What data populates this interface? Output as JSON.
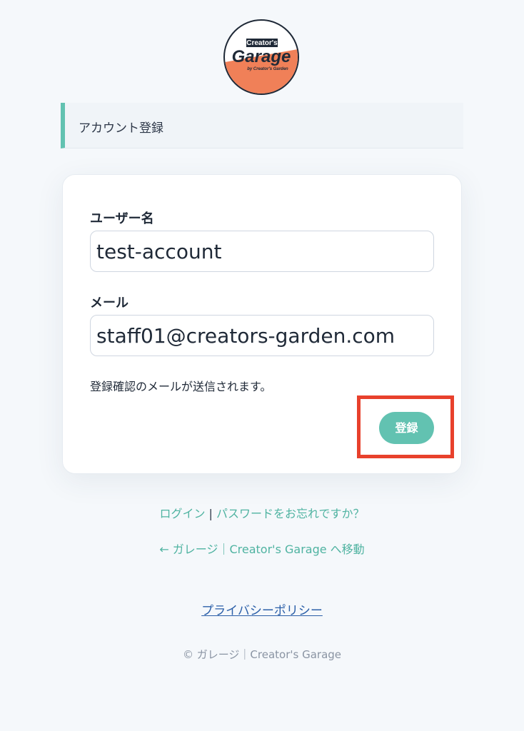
{
  "logo": {
    "line1": "Creator's",
    "line2": "Garage",
    "line3": "by Creator's Garden",
    "colors": {
      "accent": "#f08058",
      "ink": "#1f2937"
    }
  },
  "header": {
    "title": "アカウント登録"
  },
  "form": {
    "username_label": "ユーザー名",
    "username_value": "test-account",
    "email_label": "メール",
    "email_value": "staff01@creators-garden.com",
    "note": "登録確認のメールが送信されます。",
    "submit_label": "登録"
  },
  "links": {
    "login": "ログイン",
    "separator": " | ",
    "forgot_password": "パスワードをお忘れですか？",
    "back_link": "← ガレージ｜Creator's Garage へ移動"
  },
  "footer": {
    "privacy": "プライバシーポリシー",
    "copyright": "© ガレージ｜Creator's Garage"
  },
  "colors": {
    "accent": "#62c2b1",
    "highlight": "#e8412c",
    "link": "#4fb3a1",
    "privacy_link": "#2b5fa8",
    "background": "#f5f8fb"
  }
}
